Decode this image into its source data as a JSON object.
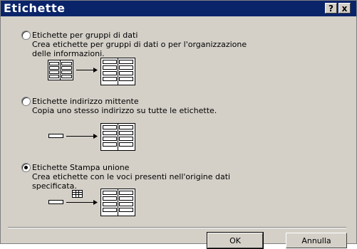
{
  "window": {
    "title": "Etichette",
    "help_label": "?",
    "close_label": "x"
  },
  "options": [
    {
      "label": "Etichette per gruppi di dati",
      "desc1": "Crea etichette per gruppi di dati o per l'organizzazione",
      "desc2": "delle informazioni.",
      "checked": false
    },
    {
      "label": "Etichette indirizzo mittente",
      "desc1": "Copia uno stesso indirizzo su tutte le etichette.",
      "desc2": "",
      "checked": false
    },
    {
      "label": "Etichette Stampa unione",
      "desc1": "Crea etichette con le voci presenti nell'origine dati",
      "desc2": "specificata.",
      "checked": true
    }
  ],
  "buttons": {
    "ok": "OK",
    "cancel": "Annulla"
  }
}
